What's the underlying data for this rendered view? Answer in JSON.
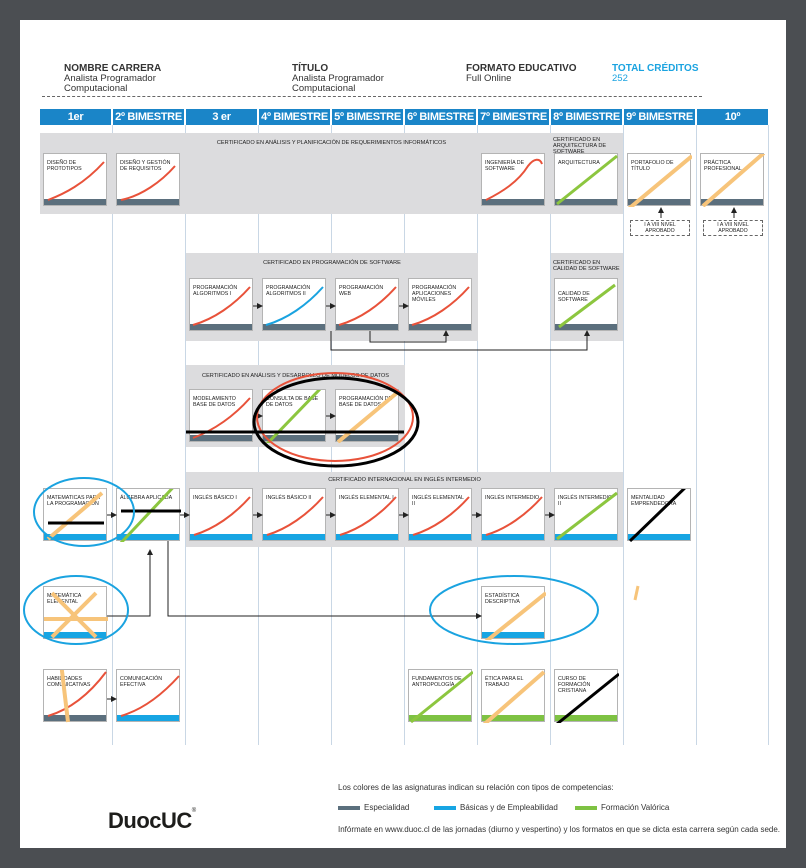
{
  "header": {
    "carrera_label": "NOMBRE CARRERA",
    "carrera_value_1": "Analista Programador",
    "carrera_value_2": "Computacional",
    "titulo_label": "TÍTULO",
    "titulo_value_1": "Analista Programador",
    "titulo_value_2": "Computacional",
    "formato_label": "FORMATO EDUCATIVO",
    "formato_value": "Full Online",
    "creditos_label": "TOTAL CRÉDITOS",
    "creditos_value": "252"
  },
  "bimestres": [
    "1er BIMESTRE",
    "2º BIMESTRE",
    "3 er BIMESTRE",
    "4º BIMESTRE",
    "5º BIMESTRE",
    "6º BIMESTRE",
    "7º BIMESTRE",
    "8º BIMESTRE",
    "9º BIMESTRE",
    "10º BIMESTRE"
  ],
  "certificados": {
    "analisis": "CERTIFICADO EN ANÁLISIS Y PLANIFICACIÓN DE REQUERIMIENTOS INFORMÁTICOS",
    "arquitectura": "CERTIFICADO EN ARQUITECTURA DE SOFTWARE",
    "programacion": "CERTIFICADO EN PROGRAMACIÓN DE SOFTWARE",
    "calidad": "CERTIFICADO EN CALIDAD DE SOFTWARE",
    "modelos": "CERTIFICADO EN ANÁLISIS Y DESARROLLO DE MODELOS DE DATOS",
    "ingles": "CERTIFICADO INTERNACIONAL EN INGLÉS INTERMEDIO"
  },
  "courses": {
    "diseno_prototipos": "DISEÑO DE PROTOTIPOS",
    "diseno_requisitos": "DISEÑO Y GESTIÓN DE REQUISITOS",
    "ingenieria_software": "INGENIERÍA DE SOFTWARE",
    "arquitectura": "ARQUITECTURA",
    "portafolio": "PORTAFOLIO DE TÍTULO",
    "practica": "PRÁCTICA PROFESIONAL",
    "prog_algoritmos_1": "PROGRAMACIÓN ALGORITMOS I",
    "prog_algoritmos_2": "PROGRAMACIÓN ALGORITMOS II",
    "prog_web": "PROGRAMACIÓN WEB",
    "prog_moviles": "PROGRAMACIÓN APLICACIONES MÓVILES",
    "calidad_software": "CALIDAD DE SOFTWARE",
    "modelamiento": "MODELAMIENTO BASE DE DATOS",
    "consulta": "CONSULTA DE BASE DE DATOS",
    "programacion_bd": "PROGRAMACIÓN DE BASE DE DATOS",
    "matematicas_prog": "MATEMATICAS PARA LA PROGRAMACIÓN",
    "algebra": "ÁLGEBRA APLICADA",
    "ingles_basico_1": "INGLÉS BÁSICO I",
    "ingles_basico_2": "INGLÉS BÁSICO II",
    "ingles_elemental_1": "INGLÉS ELEMENTAL I",
    "ingles_elemental_2": "INGLÉS ELEMENTAL II",
    "ingles_intermedio": "INGLÉS INTERMEDIO",
    "ingles_intermedio_2": "INGLÉS INTERMEDIO II",
    "mentalidad": "MENTALIDAD EMPRENDEDORA",
    "matematica_elemental": "MATEMÁTICA ELEMENTAL",
    "estadistica": "ESTADÍSTICA DESCRIPTIVA",
    "habilidades": "HABILIDADES COMUNICATIVAS",
    "comunicacion": "COMUNICACIÓN EFECTIVA",
    "antropologia": "FUNDAMENTOS DE ANTROPOLOGÍA",
    "etica": "ÉTICA PARA EL TRABAJO",
    "formacion_cristiana": "CURSO DE FORMACIÓN CRISTIANA"
  },
  "notes": {
    "nivel_9": "I A VIII NIVEL APROBADO",
    "nivel_10": "I A VIII NIVEL APROBADO"
  },
  "legend": {
    "intro": "Los colores de las asignaturas indican su relación con tipos de competencias:",
    "especialidad": "Especialidad",
    "basicas": "Básicas y de Empleabilidad",
    "valorica": "Formación Valórica"
  },
  "footer": "Infórmate en www.duoc.cl de las jornadas (diurno y vespertino) y los formatos en que se dicta esta carrera según cada sede.",
  "logo": "DuocUC",
  "colors": {
    "especialidad": "#5b6f7d",
    "basicas": "#17a5e3",
    "valorica": "#7ec243",
    "header_bar": "#1a85c8"
  }
}
